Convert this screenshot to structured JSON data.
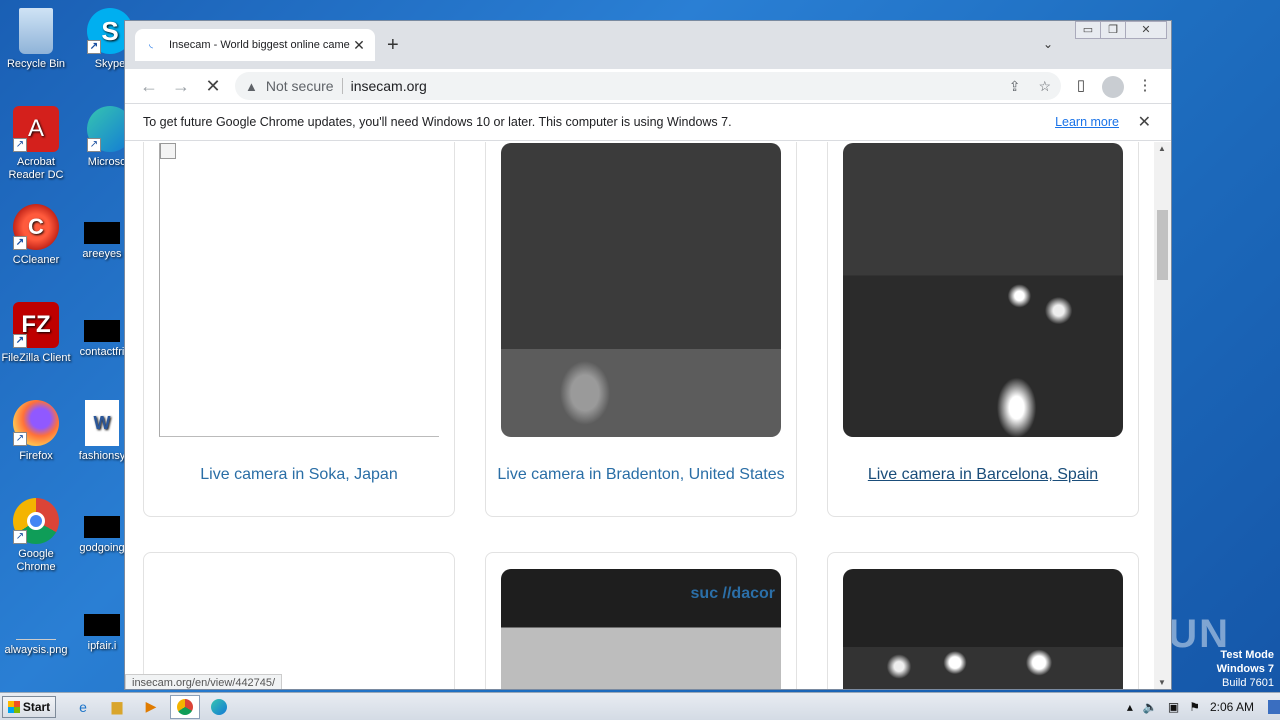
{
  "desktop": {
    "icons": [
      {
        "label": "Recycle Bin",
        "icon": "recycle-bin-icon"
      },
      {
        "label": "Skype",
        "icon": "skype-icon"
      },
      {
        "label": "Acrobat Reader DC",
        "icon": "acrobat-icon"
      },
      {
        "label": "Microsoft",
        "icon": "edge-icon"
      },
      {
        "label": "CCleaner",
        "icon": "ccleaner-icon"
      },
      {
        "label": "areeyes",
        "icon": "file-icon"
      },
      {
        "label": "FileZilla Client",
        "icon": "filezilla-icon"
      },
      {
        "label": "contactfri",
        "icon": "file-icon"
      },
      {
        "label": "Firefox",
        "icon": "firefox-icon"
      },
      {
        "label": "fashionsy",
        "icon": "word-icon"
      },
      {
        "label": "Google Chrome",
        "icon": "chrome-icon"
      },
      {
        "label": "godgoing",
        "icon": "file-icon"
      },
      {
        "label": "alwaysis.png",
        "icon": "image-icon"
      },
      {
        "label": "ipfair.i",
        "icon": "file-icon"
      }
    ],
    "watermark": "ANY RUN",
    "test_mode": {
      "line1": "Test Mode",
      "line2": "Windows 7",
      "line3": "Build 7601"
    }
  },
  "browser": {
    "tab_title": "Insecam - World biggest online came",
    "address": {
      "security": "Not secure",
      "url": "insecam.org"
    },
    "infobar": {
      "message": "To get future Google Chrome updates, you'll need Windows 10 or later. This computer is using Windows 7.",
      "link": "Learn more"
    },
    "cameras": [
      {
        "label": "Live camera in Soka, Japan"
      },
      {
        "label": "Live camera in Bradenton, United States"
      },
      {
        "label": "Live camera in Barcelona, Spain"
      }
    ],
    "cam_overlay_text": "suc //dacor",
    "status_url": "insecam.org/en/view/442745/"
  },
  "taskbar": {
    "start_label": "Start",
    "clock": "2:06 AM"
  }
}
